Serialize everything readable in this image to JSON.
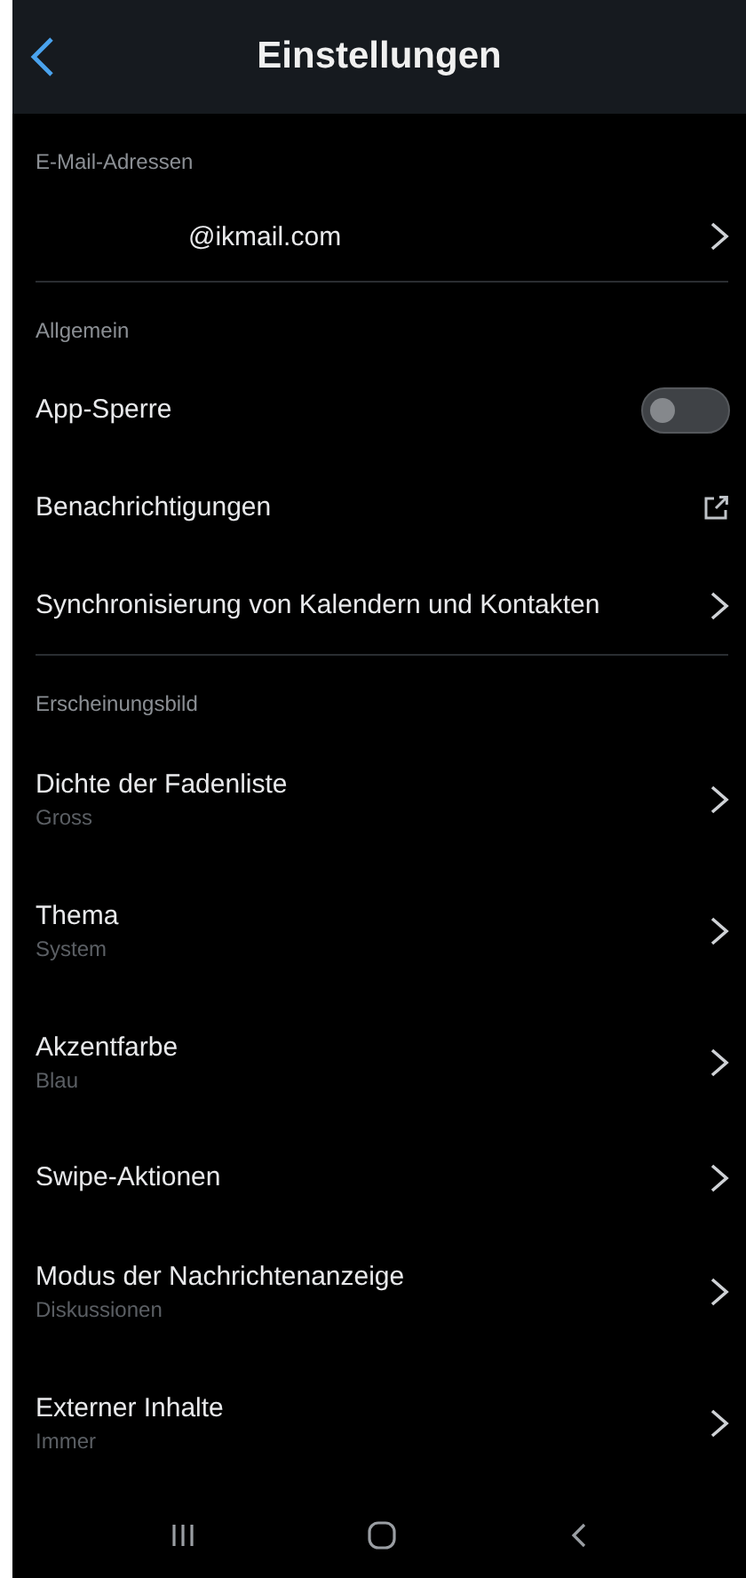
{
  "header": {
    "title": "Einstellungen"
  },
  "sections": [
    {
      "title": "E-Mail-Adressen",
      "items": [
        {
          "kind": "account",
          "label": "@ikmail.com"
        }
      ]
    },
    {
      "title": "Allgemein",
      "items": [
        {
          "kind": "toggle",
          "label": "App-Sperre",
          "on": false
        },
        {
          "kind": "external",
          "label": "Benachrichtigungen"
        },
        {
          "kind": "link",
          "label": "Synchronisierung von Kalendern und Kontakten"
        }
      ]
    },
    {
      "title": "Erscheinungsbild",
      "items": [
        {
          "kind": "link",
          "label": "Dichte der Fadenliste",
          "value": "Gross"
        },
        {
          "kind": "link",
          "label": "Thema",
          "value": "System"
        },
        {
          "kind": "link",
          "label": "Akzentfarbe",
          "value": "Blau"
        },
        {
          "kind": "link",
          "label": "Swipe-Aktionen"
        },
        {
          "kind": "link",
          "label": "Modus der Nachrichtenanzeige",
          "value": "Diskussionen"
        },
        {
          "kind": "link",
          "label": "Externer Inhalte",
          "value": "Immer"
        }
      ]
    }
  ]
}
